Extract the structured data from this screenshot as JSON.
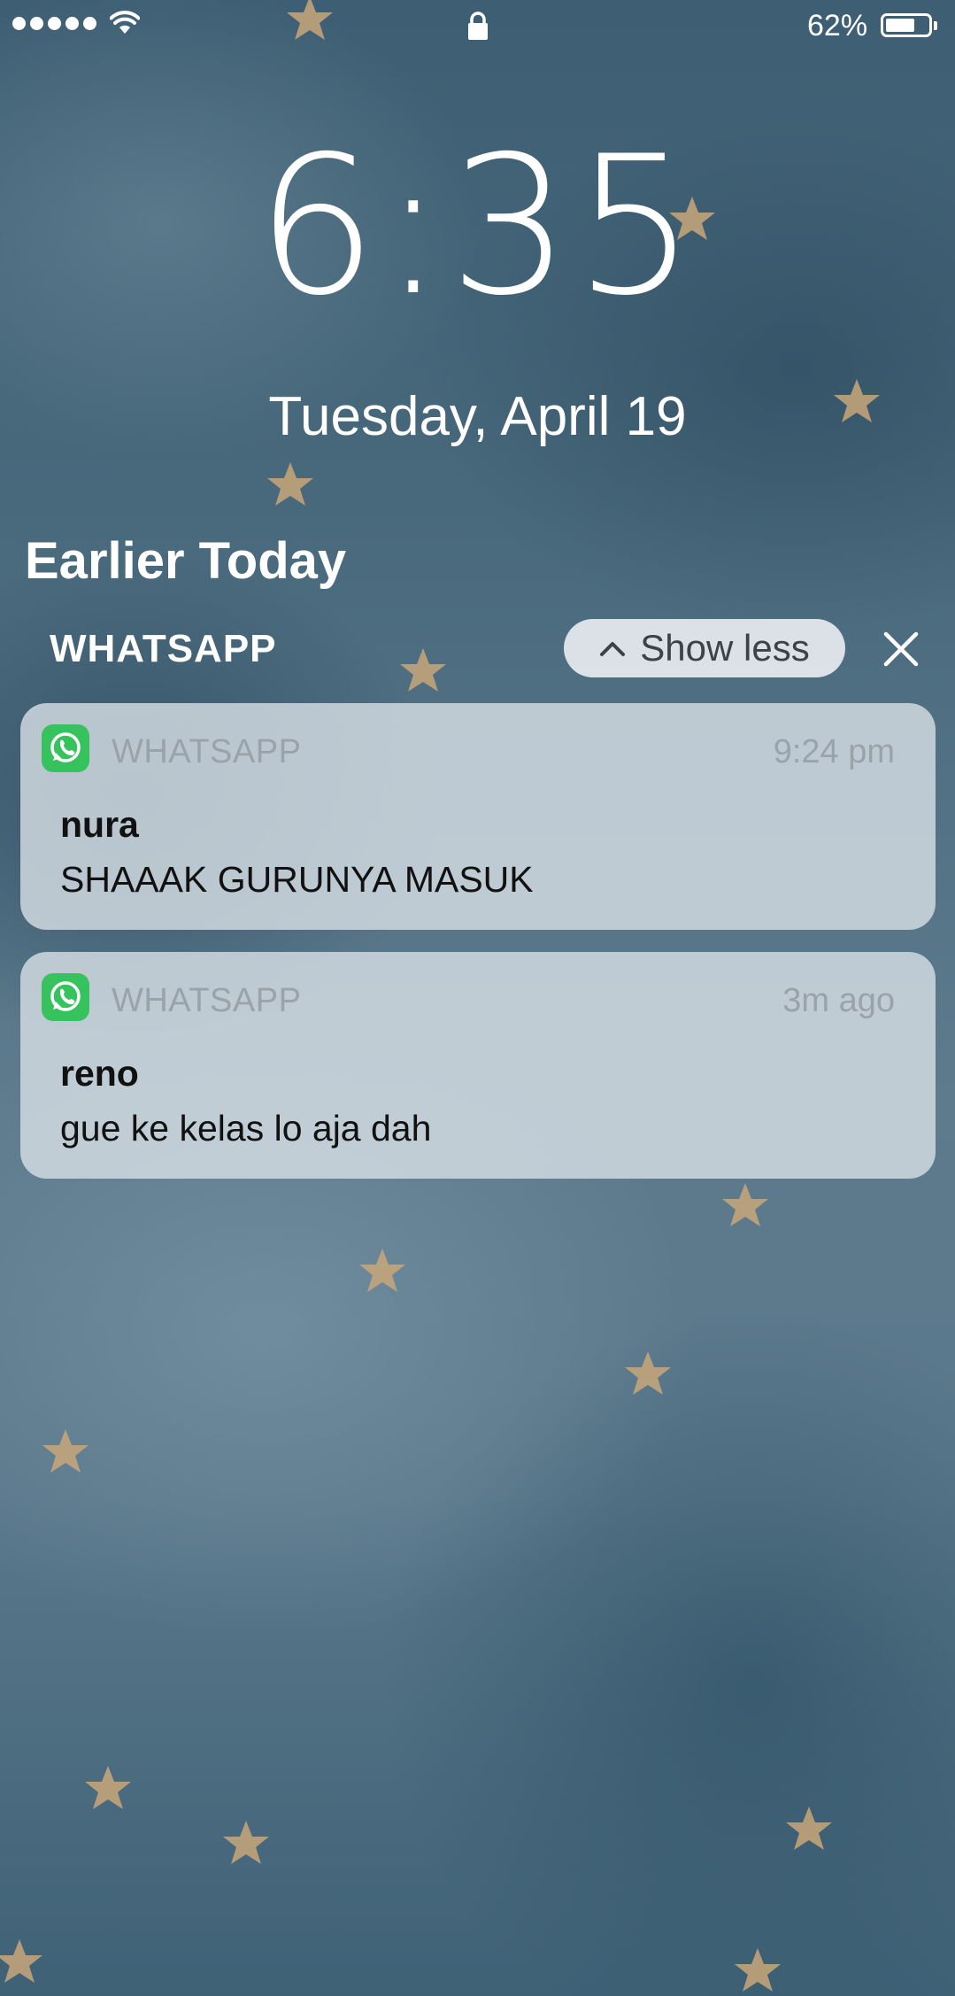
{
  "status_bar": {
    "battery_percent": "62%",
    "battery_level": 0.62,
    "signal_bars": 5,
    "icons": [
      "signal-icon",
      "wifi-icon",
      "lock-icon",
      "battery-icon"
    ]
  },
  "lock_screen": {
    "time": "6:35",
    "date": "Tuesday, April 19",
    "section_title": "Earlier Today",
    "group_title": "WHATSAPP",
    "show_less_label": "Show less",
    "show_less_icon": "chevron-up-icon",
    "close_icon": "close-icon"
  },
  "notifications": [
    {
      "app": "WHATSAPP",
      "icon": "whatsapp-icon",
      "time": "9:24 pm",
      "sender": "nura",
      "message": "SHAAAK GURUNYA MASUK"
    },
    {
      "app": "WHATSAPP",
      "icon": "whatsapp-icon",
      "time": "3m ago",
      "sender": "reno",
      "message": "gue ke kelas lo aja dah"
    }
  ],
  "colors": {
    "whatsapp_green": "#36c25c",
    "card_background": "#d6dee4",
    "muted_text": "#9aa3aa"
  }
}
